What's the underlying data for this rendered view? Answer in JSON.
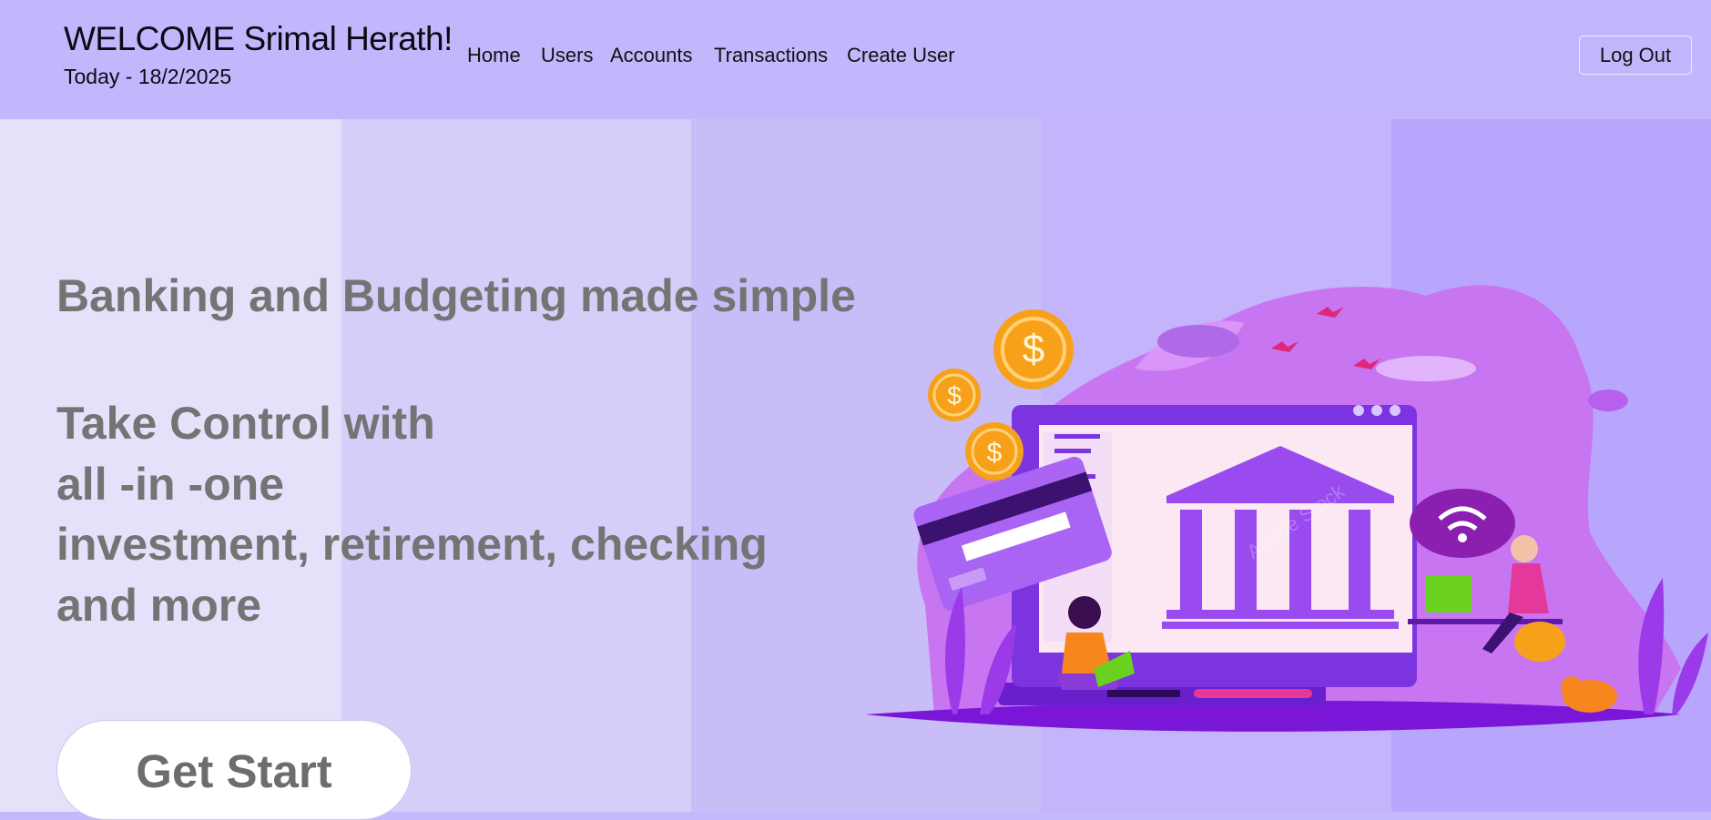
{
  "header": {
    "welcome": "WELCOME Srimal Herath!",
    "today": "Today - 18/2/2025",
    "nav": [
      "Home",
      "Users",
      "Accounts",
      "Transactions",
      "Create User"
    ],
    "logout_label": "Log Out"
  },
  "hero": {
    "headline": "Banking and Budgeting made simple",
    "lines": [
      "Take Control with",
      "all -in -one",
      "investment, retirement, checking",
      "and more"
    ],
    "cta_label": "Get Start"
  },
  "illustration": {
    "icons": [
      "bank-icon",
      "dollar-coin-icon",
      "credit-card-icon",
      "wifi-cloud-icon",
      "person-icon",
      "cat-icon",
      "bird-icon"
    ],
    "watermark": "Adobe Stock"
  },
  "colors": {
    "header_bg": "#c4b6fc",
    "stripes": [
      "#e6e0fb",
      "#d6cdf8",
      "#c9bdf8",
      "#c3b4fc",
      "#b8a6fd"
    ],
    "hero_text": "#747474",
    "accent_purple": "#9a4bf0",
    "coin_orange": "#f7a11a"
  }
}
